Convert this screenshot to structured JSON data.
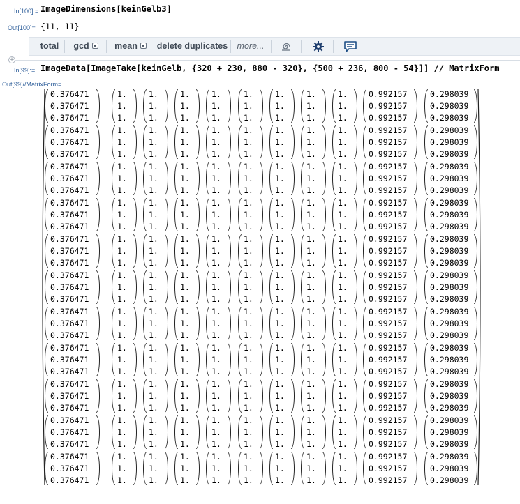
{
  "cells": {
    "in100_label": "In[100]:=",
    "in100_code": "ImageDimensions[keinGelb3]",
    "out100_label": "Out[100]=",
    "out100_value": "{11, 11}",
    "in99_label": "In[99]:=",
    "in99_code": "ImageData[ImageTake[keinGelb, {320 + 230, 880 - 320}, {500 + 236, 800 - 54}]] // MatrixForm",
    "out99_label": "Out[99]//MatrixForm="
  },
  "suggestions": {
    "total": "total",
    "gcd": "gcd",
    "mean": "mean",
    "delete_duplicates": "delete duplicates",
    "more": "more...",
    "icons": [
      "spiral-icon",
      "gear-icon",
      "feedback-icon"
    ]
  },
  "matrix": {
    "rows": 11,
    "sub_rows": 3,
    "columns": [
      "0.376471",
      "1.",
      "1.",
      "1.",
      "1.",
      "1.",
      "1.",
      "1.",
      "1.",
      "0.992157",
      "0.298039"
    ]
  },
  "colors": {
    "label_blue": "#2e5e9a",
    "bar_bg": "#eef2f6",
    "bar_text": "#404a56",
    "gear_blue": "#1f3e6e",
    "chat_blue": "#1f4f86"
  }
}
